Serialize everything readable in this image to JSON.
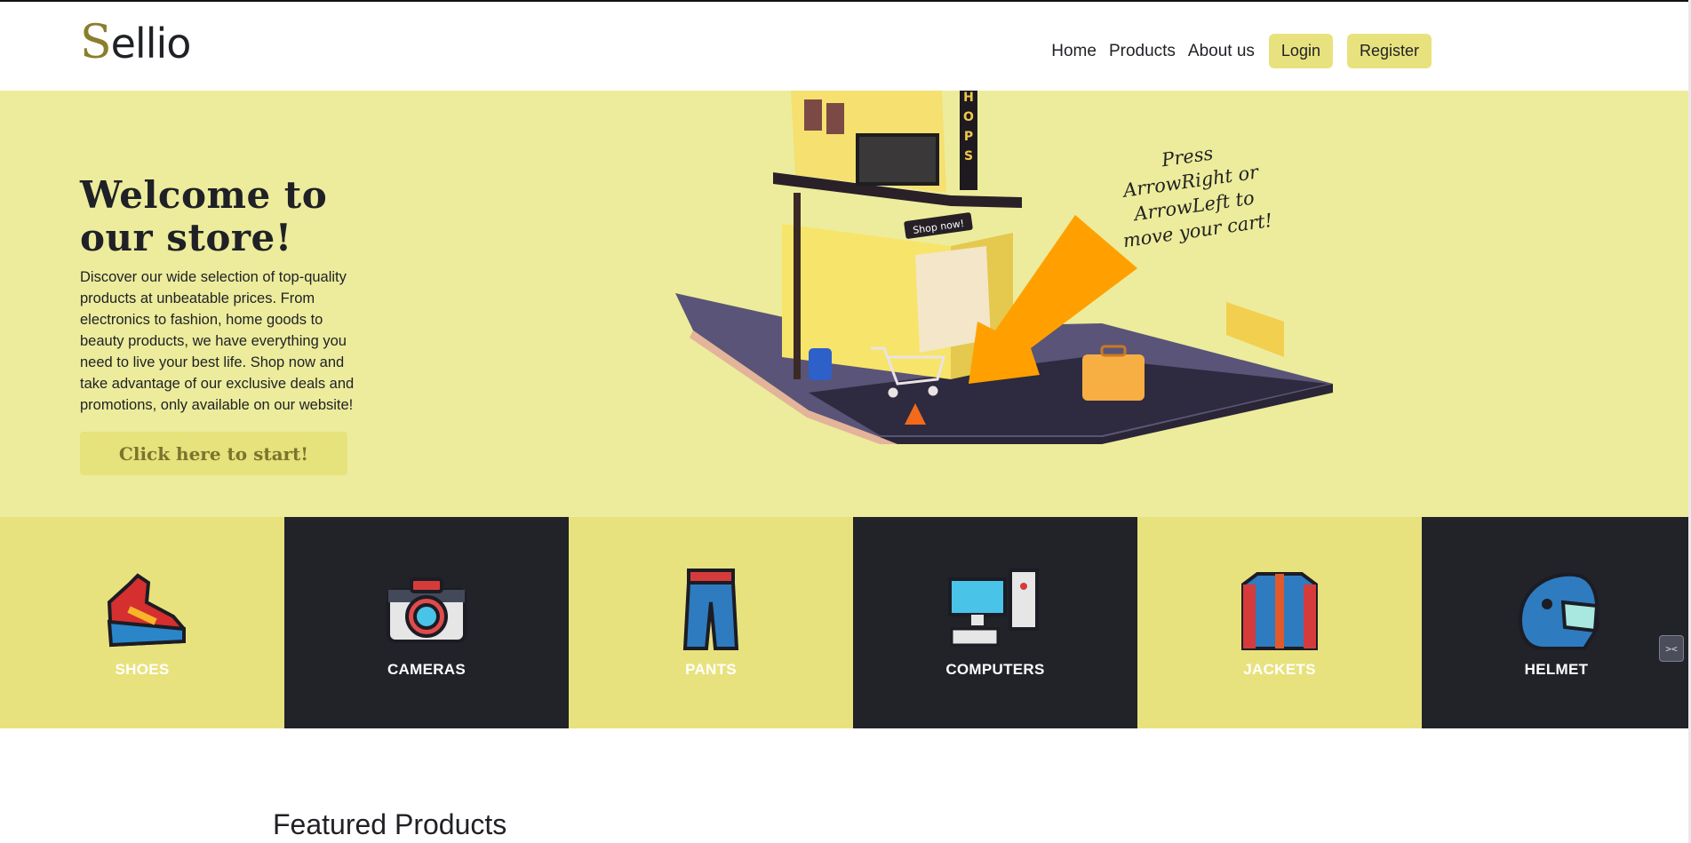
{
  "header": {
    "logo_first": "S",
    "logo_rest": "ellio",
    "nav": [
      "Home",
      "Products",
      "About us"
    ],
    "login_label": "Login",
    "register_label": "Register"
  },
  "hero": {
    "title": "Welcome to our store!",
    "text": "Discover our wide selection of top-quality products at unbeatable prices. From electronics to fashion, home goods to beauty products, we have everything you need to live your best life. Shop now and take advantage of our exclusive deals and promotions, only available on our website!",
    "cta_label": "Click here to start!",
    "hint": "Press ArrowRight or ArrowLeft to move your cart!",
    "shop_sign": "Shop now!",
    "building_sign": "SHOPS"
  },
  "categories": [
    {
      "label": "SHOES",
      "icon": "shoe-icon"
    },
    {
      "label": "CAMERAS",
      "icon": "camera-icon"
    },
    {
      "label": "PANTS",
      "icon": "pants-icon"
    },
    {
      "label": "COMPUTERS",
      "icon": "computer-icon"
    },
    {
      "label": "JACKETS",
      "icon": "jacket-icon"
    },
    {
      "label": "HELMET",
      "icon": "helmet-icon"
    }
  ],
  "side_widget": "><",
  "featured_title": "Featured Products",
  "colors": {
    "accent_yellow": "#e8e27e",
    "hero_bg": "#ecec9c",
    "dark": "#212329",
    "arrow_orange": "#ffa000"
  }
}
